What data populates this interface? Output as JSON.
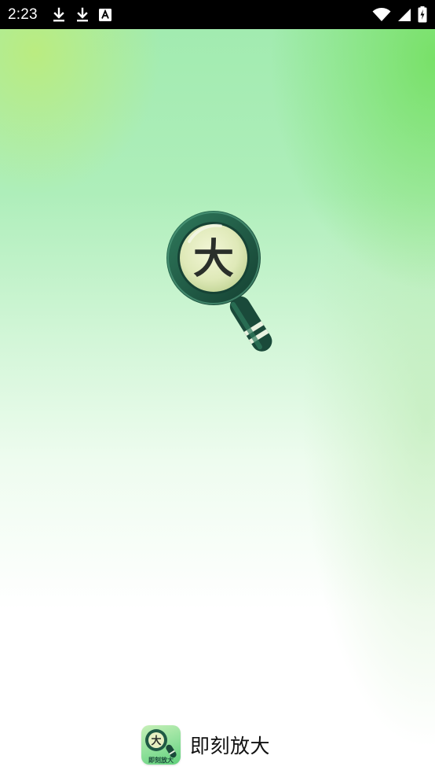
{
  "status_bar": {
    "time": "2:23",
    "notification_icons": [
      "download-icon",
      "download-icon",
      "keyboard-a-icon"
    ],
    "system_icons": [
      "wifi-icon",
      "cell-signal-icon",
      "battery-icon"
    ]
  },
  "splash": {
    "logo_icon": "magnifier-icon",
    "logo_glyph": "大",
    "app_icon": "app-icon",
    "app_icon_caption": "即刻放大",
    "app_name": "即刻放大"
  },
  "colors": {
    "status_bar_bg": "#000000",
    "gradient_top": "#a2ebb0",
    "gradient_accent": "#76e064",
    "magnifier_rim": "#1f5a45",
    "lens": "#e6f0c2"
  }
}
